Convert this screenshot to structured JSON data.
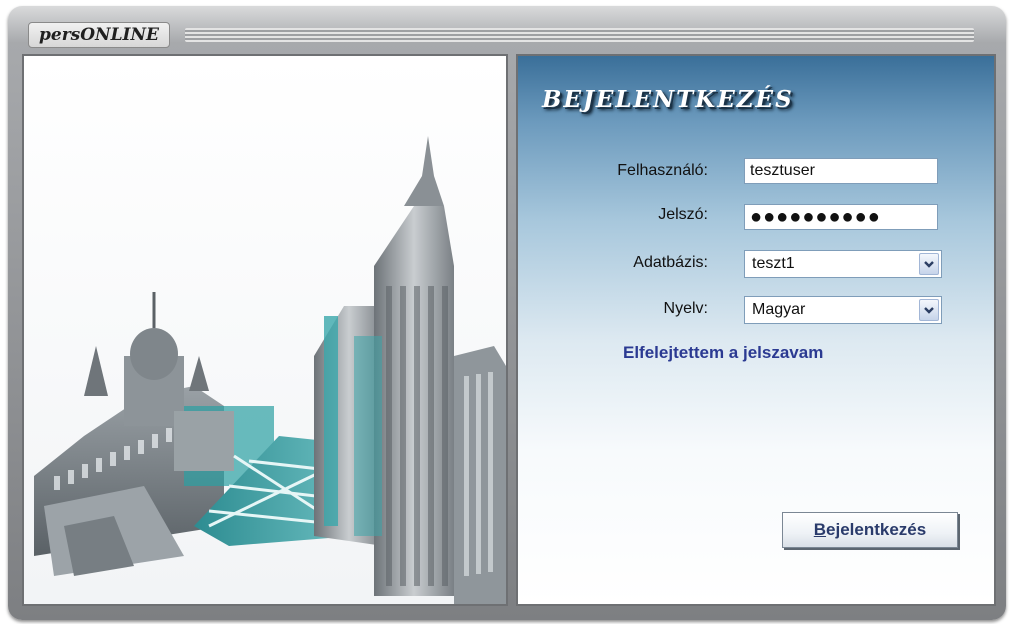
{
  "window": {
    "title": "persONLINE"
  },
  "login": {
    "heading": "Bejelentkezés",
    "fields": {
      "username_label": "Felhasználó:",
      "username_value": "tesztuser",
      "password_label": "Jelszó:",
      "password_value": "●●●●●●●●●●",
      "database_label": "Adatbázis:",
      "database_value": "teszt1",
      "language_label": "Nyelv:",
      "language_value": "Magyar"
    },
    "forgot_link": "Elfelejtettem a jelszavam",
    "submit_first_letter": "B",
    "submit_rest": "ejelentkezés"
  },
  "colors": {
    "panel_gradient_top": "#3a6f99",
    "link": "#2b3a92",
    "teal_accent": "#2fa3a8"
  },
  "icons": {
    "dropdown": "chevron-down-icon",
    "illustration": "city-illustration"
  }
}
